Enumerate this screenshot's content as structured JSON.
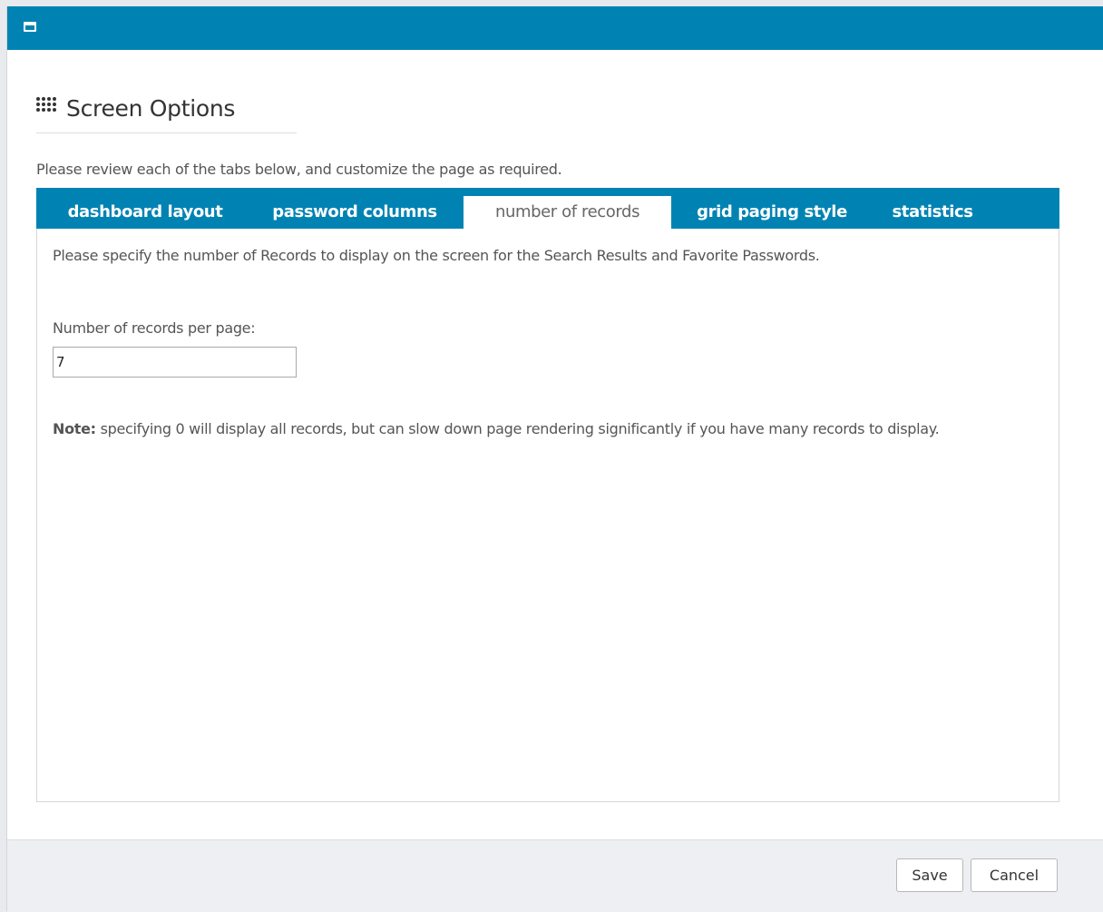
{
  "titlebar": {
    "icon": "window-icon"
  },
  "header": {
    "icon": "grip-dots-icon",
    "title": "Screen Options"
  },
  "intro": "Please review each of the tabs below, and customize the page as required.",
  "tabs": [
    {
      "label": "dashboard layout",
      "active": false
    },
    {
      "label": "password columns",
      "active": false
    },
    {
      "label": "number of records",
      "active": true
    },
    {
      "label": "grid paging style",
      "active": false
    },
    {
      "label": "statistics",
      "active": false
    }
  ],
  "panel": {
    "description": "Please specify the number of Records to display on the screen for the Search Results and Favorite Passwords.",
    "field_label": "Number of records per page:",
    "records_value": "7",
    "note_bold": "Note:",
    "note_text": " specifying 0 will display all records, but can slow down page rendering significantly if you have many records to display."
  },
  "footer": {
    "save_label": "Save",
    "cancel_label": "Cancel"
  },
  "colors": {
    "accent": "#0083b3",
    "footer_bg": "#eeeff2",
    "text": "#555555"
  }
}
